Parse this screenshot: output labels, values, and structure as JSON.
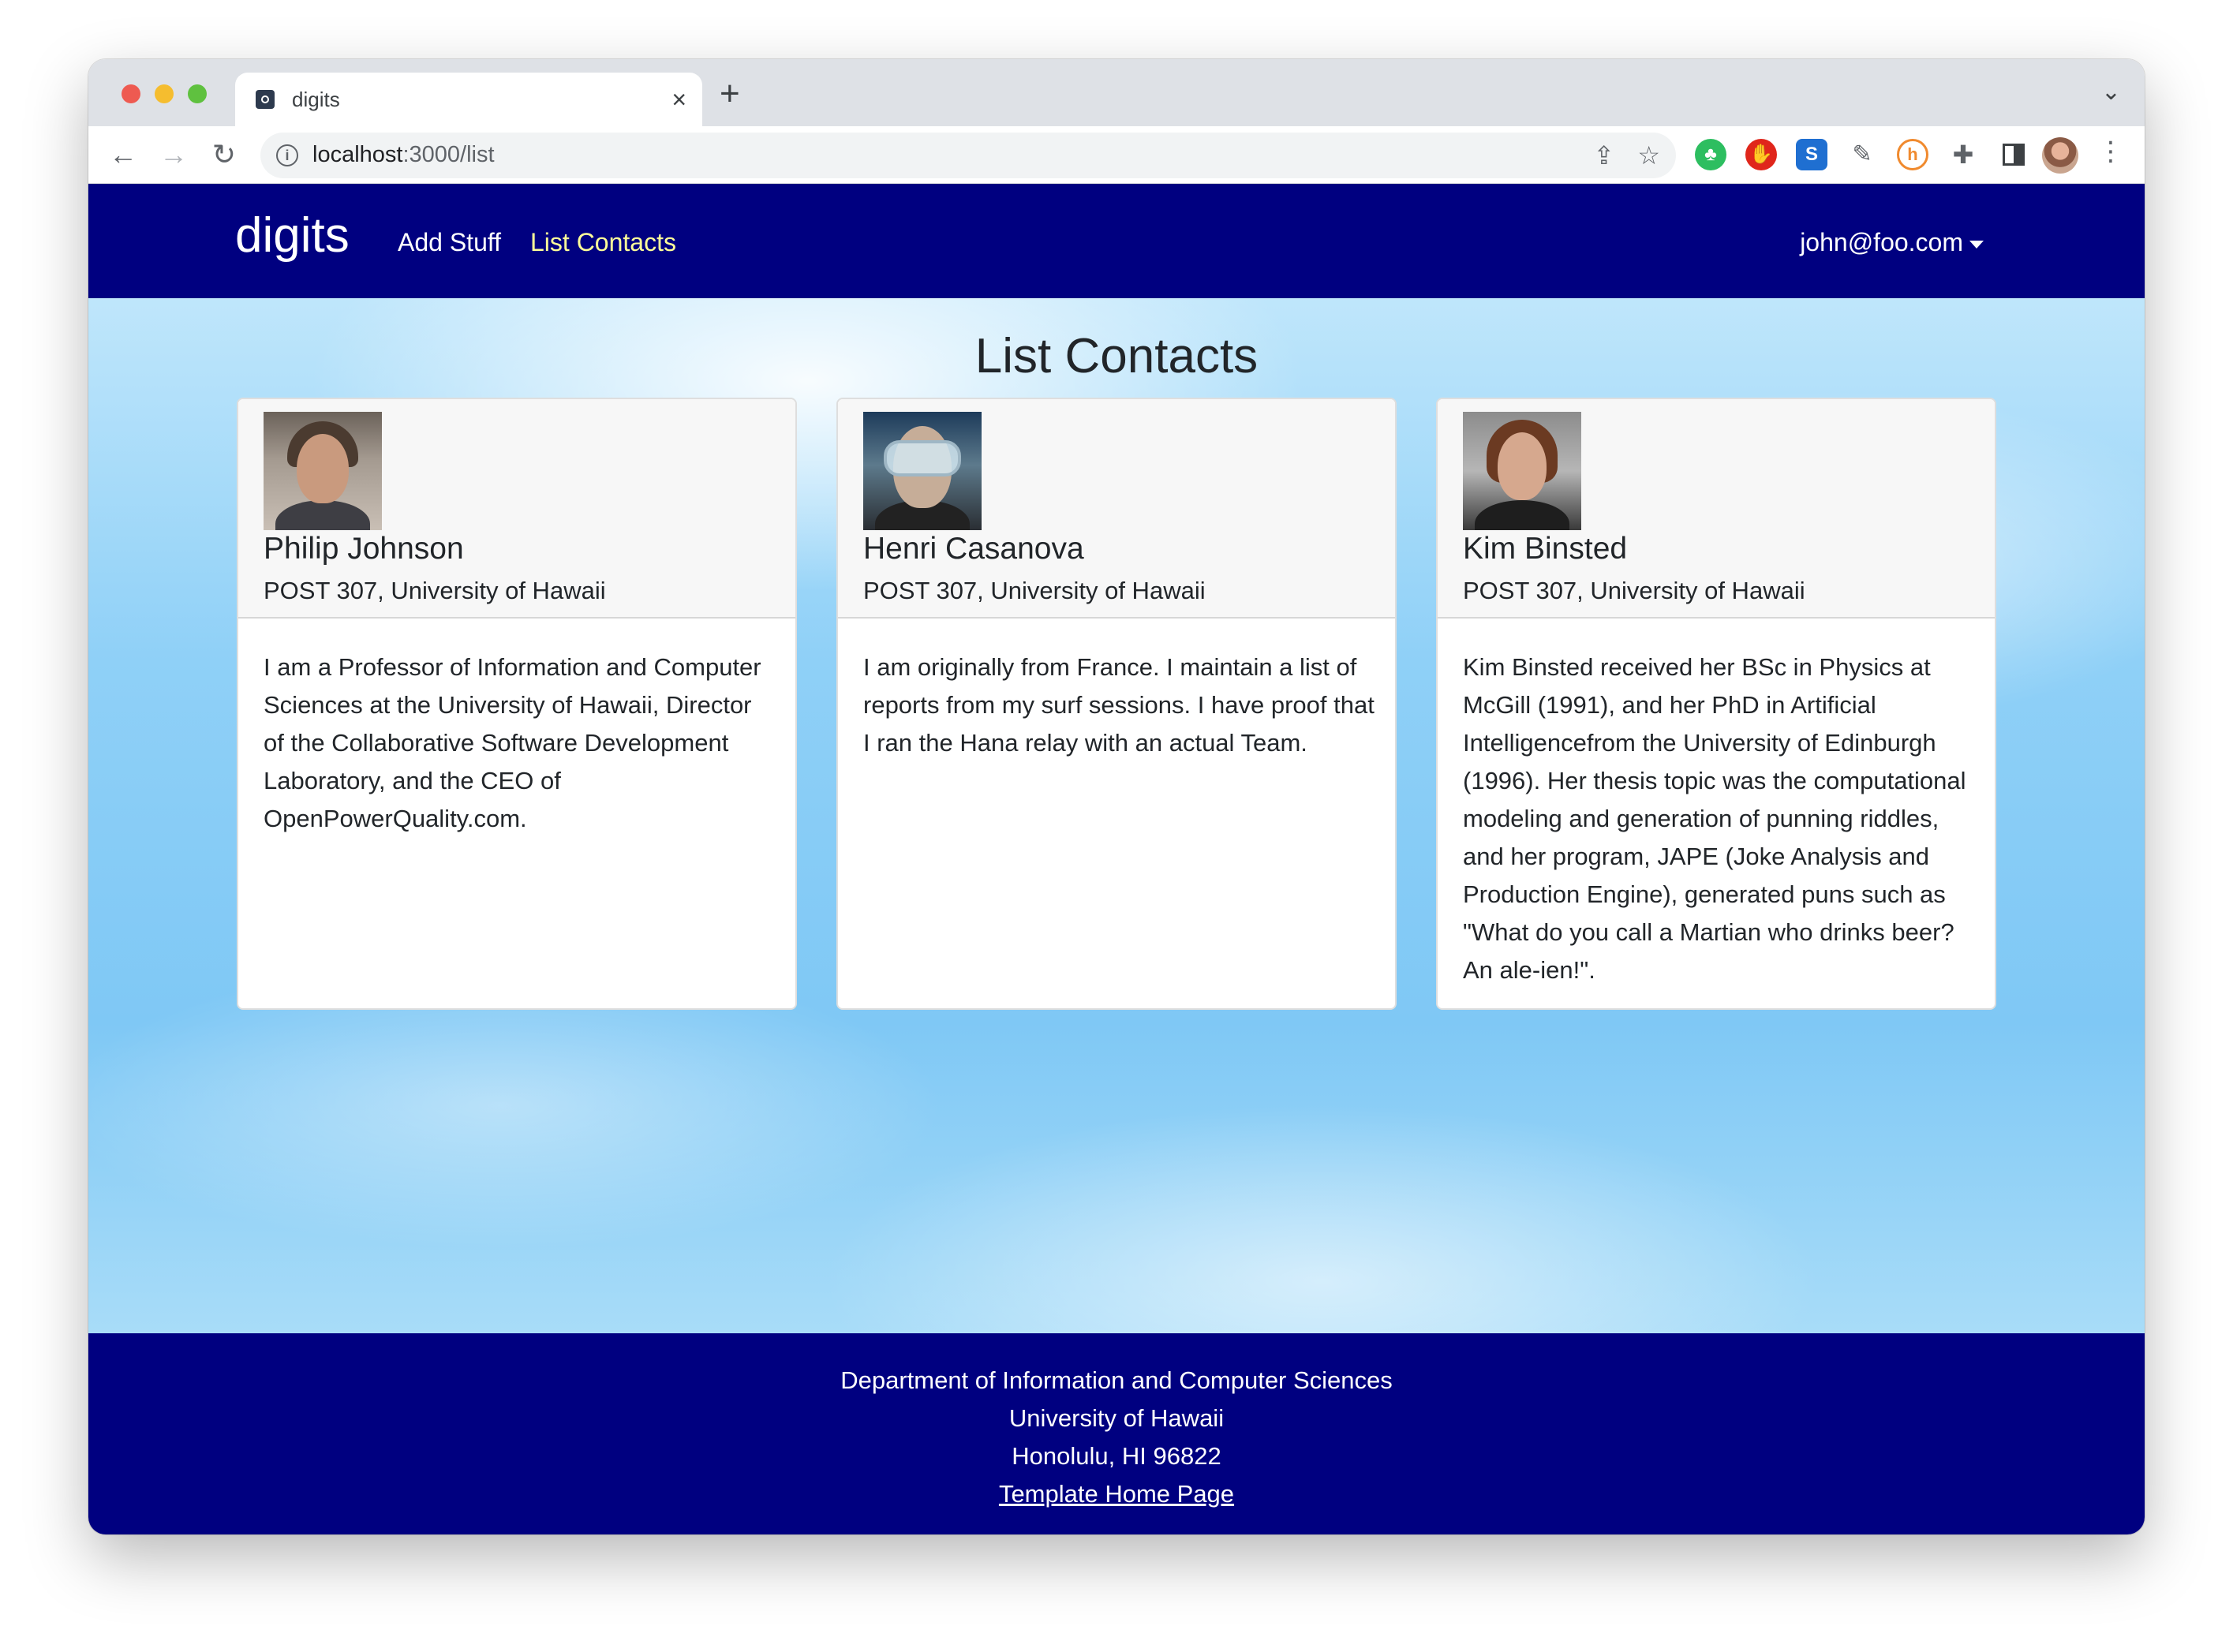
{
  "browser": {
    "tab_title": "digits",
    "tab_close": "×",
    "new_tab": "+",
    "url_host": "localhost",
    "url_path": ":3000/list"
  },
  "navbar": {
    "brand": "digits",
    "links": [
      {
        "label": "Add Stuff",
        "active": false
      },
      {
        "label": "List Contacts",
        "active": true
      }
    ],
    "user": "john@foo.com"
  },
  "main": {
    "title": "List Contacts",
    "contacts": [
      {
        "name": "Philip Johnson",
        "address": "POST 307, University of Hawaii",
        "description": "I am a Professor of Information and Computer Sciences at the University of Hawaii, Director of the Collaborative Software Development Laboratory, and the CEO of OpenPowerQuality.com."
      },
      {
        "name": "Henri Casanova",
        "address": "POST 307, University of Hawaii",
        "description": "I am originally from France. I maintain a list of reports from my surf sessions. I have proof that I ran the Hana relay with an actual Team."
      },
      {
        "name": "Kim Binsted",
        "address": "POST 307, University of Hawaii",
        "description": "Kim Binsted received her BSc in Physics at McGill (1991), and her PhD in Artificial Intelligencefrom the University of Edinburgh (1996). Her thesis topic was the computational modeling and generation of punning riddles, and her program, JAPE (Joke Analysis and Production Engine), generated puns such as \"What do you call a Martian who drinks beer? An ale-ien!\"."
      }
    ]
  },
  "footer": {
    "line1": "Department of Information and Computer Sciences",
    "line2": "University of Hawaii",
    "line3": "Honolulu, HI 96822",
    "link": "Template Home Page"
  },
  "colors": {
    "navbar": "#000080",
    "active_link": "#ffff99"
  }
}
